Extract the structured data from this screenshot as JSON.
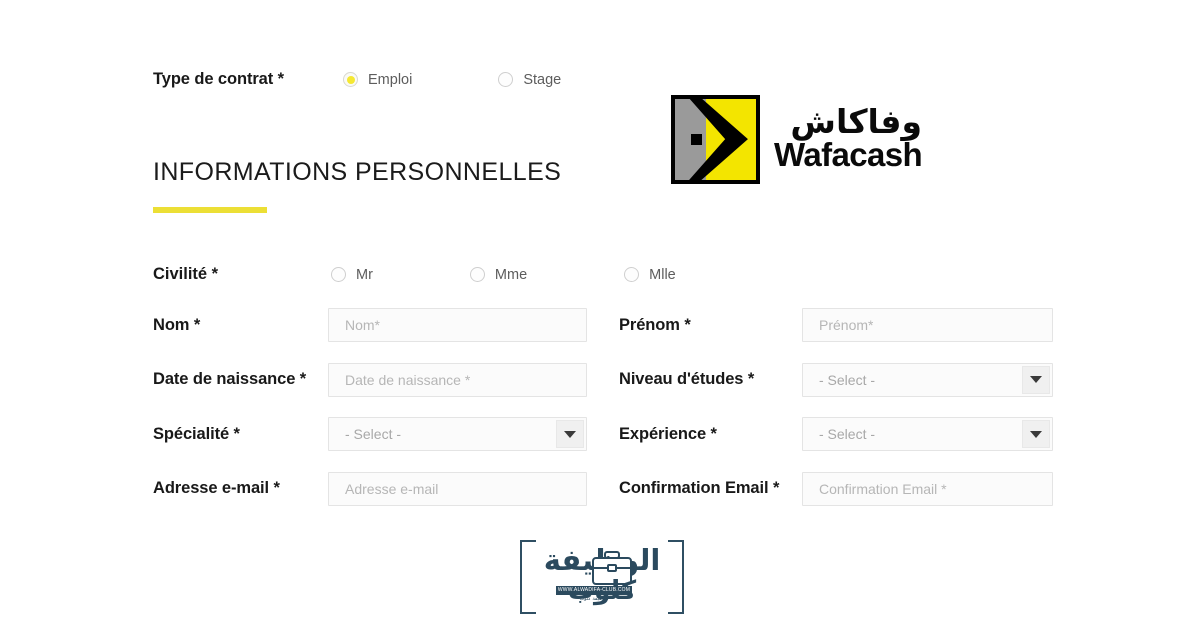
{
  "contract": {
    "label": "Type de contrat *",
    "options": [
      {
        "label": "Emploi",
        "selected": true
      },
      {
        "label": "Stage",
        "selected": false
      }
    ]
  },
  "section": {
    "title": "INFORMATIONS PERSONNELLES"
  },
  "brand": {
    "arabic": "وفاكاش",
    "latin": "Wafacash",
    "colors": {
      "yellow": "#f3e500",
      "gray": "#9a9a9a",
      "black": "#000000"
    }
  },
  "civilite": {
    "label": "Civilité *",
    "options": [
      {
        "label": "Mr",
        "selected": false
      },
      {
        "label": "Mme",
        "selected": false
      },
      {
        "label": "Mlle",
        "selected": false
      }
    ]
  },
  "fields": {
    "nom": {
      "label": "Nom *",
      "placeholder": "Nom*",
      "value": "",
      "type": "text"
    },
    "prenom": {
      "label": "Prénom *",
      "placeholder": "Prénom*",
      "value": "",
      "type": "text"
    },
    "date_naissance": {
      "label": "Date de naissance *",
      "placeholder": "Date de naissance *",
      "value": "",
      "type": "text"
    },
    "niveau_etudes": {
      "label": "Niveau d'études *",
      "placeholder": "- Select -",
      "value": "- Select -",
      "type": "select"
    },
    "specialite": {
      "label": "Spécialité *",
      "placeholder": "- Select -",
      "value": "- Select -",
      "type": "select"
    },
    "experience": {
      "label": "Expérience *",
      "placeholder": "- Select -",
      "value": "- Select -",
      "type": "select"
    },
    "adresse_email": {
      "label": "Adresse e-mail *",
      "placeholder": "Adresse e-mail",
      "value": "",
      "type": "text"
    },
    "confirmation_email": {
      "label": "Confirmation Email *",
      "placeholder": "Confirmation Email *",
      "value": "",
      "type": "text"
    }
  },
  "watermark": {
    "arabic_top": "الوظيفة",
    "arabic_bottom": "كلوب",
    "url": "WWW.ALWADIFA-CLUB.COM",
    "subtitle": "الوظيفة كلوب"
  },
  "theme": {
    "accent_yellow": "#ecdf35",
    "radio_yellow": "#f5e833",
    "text_dark": "#191919",
    "placeholder_gray": "#b6b6b6",
    "background": "#ffffff"
  }
}
